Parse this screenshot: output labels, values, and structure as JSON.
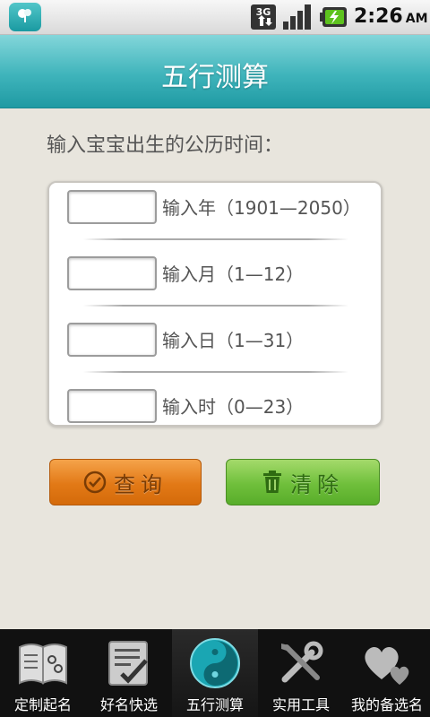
{
  "status": {
    "network": "3G",
    "time": "2:26",
    "ampm": "AM"
  },
  "header": {
    "title": "五行测算"
  },
  "form": {
    "prompt": "输入宝宝出生的公历时间：",
    "fields": [
      {
        "label": "输入年（1901—2050）",
        "value": ""
      },
      {
        "label": "输入月（1—12）",
        "value": ""
      },
      {
        "label": "输入日（1—31）",
        "value": ""
      },
      {
        "label": "输入时（0—23）",
        "value": ""
      }
    ]
  },
  "buttons": {
    "query": "查询",
    "clear": "清除"
  },
  "tabs": [
    {
      "label": "定制起名",
      "icon": "book-icon"
    },
    {
      "label": "好名快选",
      "icon": "checklist-icon"
    },
    {
      "label": "五行测算",
      "icon": "yin-yang-icon",
      "active": true
    },
    {
      "label": "实用工具",
      "icon": "tools-icon"
    },
    {
      "label": "我的备选名",
      "icon": "hearts-icon"
    }
  ],
  "colors": {
    "header": "#3fb4bb",
    "query": "#e27916",
    "clear": "#6fbf3b",
    "tabbar": "#111111"
  }
}
